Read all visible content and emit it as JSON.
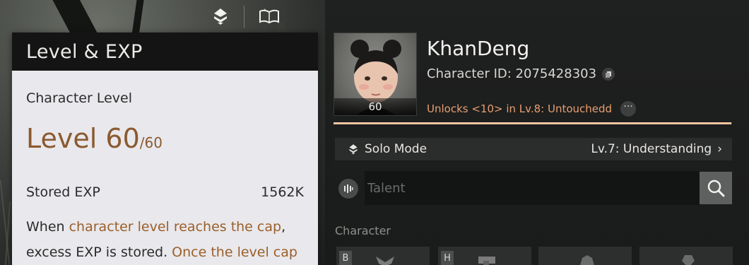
{
  "tooltip": {
    "title": "Level & EXP",
    "char_level_label": "Character Level",
    "level_text": "Level 60",
    "level_cap": "/60",
    "stored_exp_label": "Stored EXP",
    "stored_exp_value": "1562K",
    "desc_1": "When ",
    "desc_hl_1": "character level reaches the cap",
    "desc_2": ",",
    "desc_3": "excess EXP is stored. ",
    "desc_hl_2": "Once the level cap"
  },
  "character": {
    "name": "KhanDeng",
    "id_text": "Character ID: 2075428303",
    "portrait_level": "60",
    "unlock_text": "Unlocks <10> in Lv.8: Untouchedd",
    "more_label": "···",
    "progress": 0.998
  },
  "solo": {
    "label": "Solo Mode",
    "value": "Lv.7: Understanding",
    "chevron": "›"
  },
  "talent": {
    "placeholder": "Talent"
  },
  "section": {
    "character_label": "Character"
  },
  "slots": [
    {
      "key": "B"
    },
    {
      "key": "H"
    },
    {
      "key": ""
    },
    {
      "key": ""
    }
  ],
  "colors": {
    "accent_orange": "#e6a070",
    "level_brown": "#8a5a30",
    "progress": "#f0c4a0"
  },
  "icons": [
    "solo-mode-icon",
    "book-icon",
    "copy-icon",
    "more-icon",
    "talent-icon",
    "search-icon",
    "gear-icon"
  ]
}
